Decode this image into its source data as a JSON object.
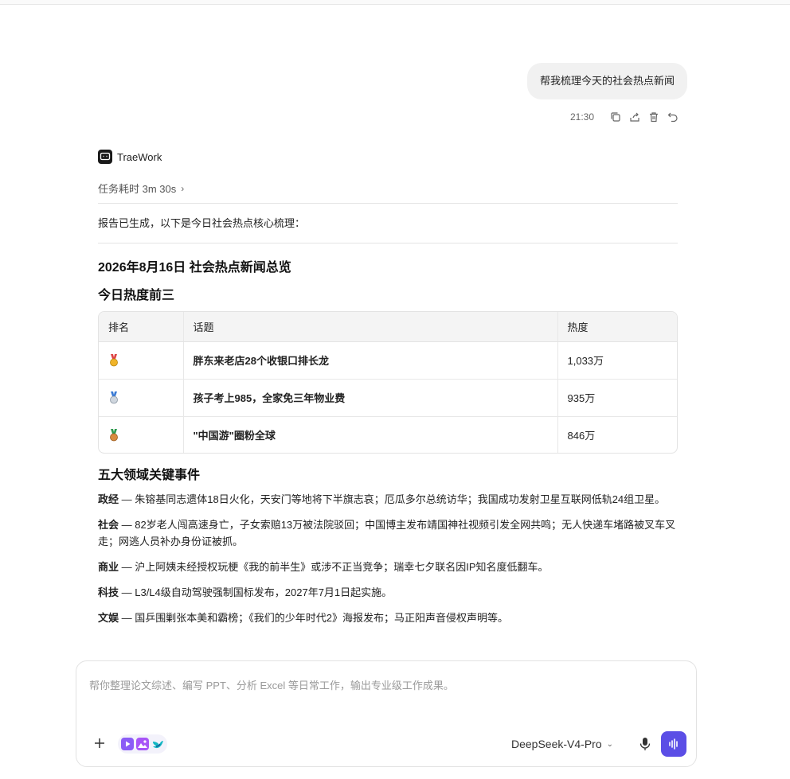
{
  "user_message": {
    "text": "帮我梳理今天的社会热点新闻",
    "time": "21:30",
    "actions": [
      "copy-icon",
      "share-icon",
      "delete-icon",
      "undo-icon"
    ]
  },
  "assistant": {
    "name": "TraeWork",
    "task_duration": "任务耗时 3m 30s",
    "intro": "报告已生成，以下是今日社会热点核心梳理："
  },
  "report": {
    "title": "2026年8月16日 社会热点新闻总览",
    "top3_heading": "今日热度前三",
    "table": {
      "headers": [
        "排名",
        "话题",
        "热度"
      ],
      "rows": [
        {
          "medal": "gold-medal-icon",
          "topic": "胖东来老店28个收银口排长龙",
          "heat": "1,033万"
        },
        {
          "medal": "silver-medal-icon",
          "topic": "孩子考上985，全家免三年物业费",
          "heat": "935万"
        },
        {
          "medal": "bronze-medal-icon",
          "topic": "\"中国游\"圈粉全球",
          "heat": "846万"
        }
      ]
    },
    "five_heading": "五大领域关键事件",
    "events": [
      {
        "label": "政经",
        "text": " — 朱镕基同志遗体18日火化，天安门等地将下半旗志哀；厄瓜多尔总统访华；我国成功发射卫星互联网低轨24组卫星。"
      },
      {
        "label": "社会",
        "text": " — 82岁老人闯高速身亡，子女索赔13万被法院驳回；中国博主发布靖国神社视频引发全网共鸣；无人快递车堵路被叉车叉走；网逃人员补办身份证被抓。"
      },
      {
        "label": "商业",
        "text": " — 沪上阿姨未经授权玩梗《我的前半生》或涉不正当竞争；瑞幸七夕联名因IP知名度低翻车。"
      },
      {
        "label": "科技",
        "text": " — L3/L4级自动驾驶强制国标发布，2027年7月1日起实施。"
      },
      {
        "label": "文娱",
        "text": " — 国乒围剿张本美和霸榜；《我们的少年时代2》海报发布；马正阳声音侵权声明等。"
      }
    ]
  },
  "composer": {
    "placeholder": "帮你整理论文综述、编写 PPT、分析 Excel 等日常工作，输出专业级工作成果。",
    "model": "DeepSeek-V4-Pro"
  },
  "colors": {
    "accent": "#5b4ee6",
    "bubble": "#f1f1f1",
    "table_header": "#f4f4f4"
  }
}
